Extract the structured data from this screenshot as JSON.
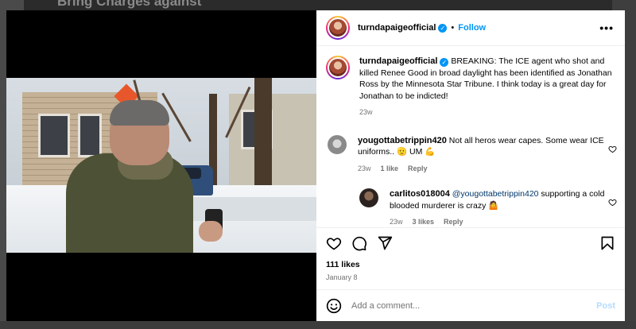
{
  "background": {
    "title": "Bring Charges against"
  },
  "post": {
    "author": "turndapaigeofficial",
    "verified": true,
    "follow_label": "Follow",
    "separator": "•",
    "more_label": "•••",
    "caption_username": "turndapaigeofficial",
    "caption_text": "BREAKING: The ICE agent who shot and killed Renee Good in broad daylight has been identified as Jonathan Ross by the Minnesota Star Tribune. I think today is a great day for Jonathan to be indicted!",
    "caption_time": "23w",
    "likes": "111 likes",
    "date": "January 8"
  },
  "comments": [
    {
      "username": "yougottabetrippin420",
      "text": "Not all heros wear capes. Some wear ICE uniforms.. 🫡 UM 💪",
      "time": "23w",
      "likes": "1 like",
      "reply_label": "Reply"
    },
    {
      "username": "carlitos018004",
      "mention": "@yougottabetrippin420",
      "text": " supporting a cold blooded murderer is crazy 🤷",
      "time": "23w",
      "likes": "3 likes",
      "reply_label": "Reply"
    }
  ],
  "composer": {
    "placeholder": "Add a comment...",
    "post_label": "Post",
    "emoji_icon": "smiley-icon"
  },
  "colors": {
    "accent": "#0095f6",
    "post_disabled": "#b3dbff",
    "secondary_text": "#737373"
  }
}
